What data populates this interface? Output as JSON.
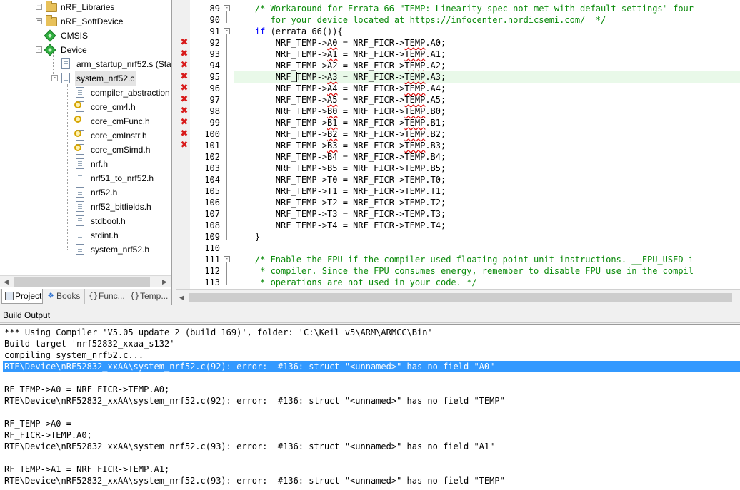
{
  "project_tree": {
    "items": [
      {
        "label": "nRF_Libraries",
        "kind": "folder"
      },
      {
        "label": "nRF_SoftDevice",
        "kind": "folder"
      },
      {
        "label": "CMSIS",
        "kind": "component"
      },
      {
        "label": "Device",
        "kind": "component"
      },
      {
        "label": "arm_startup_nrf52.s (Star",
        "kind": "file"
      },
      {
        "label": "system_nrf52.c",
        "kind": "file"
      },
      {
        "label": "compiler_abstraction",
        "kind": "file"
      },
      {
        "label": "core_cm4.h",
        "kind": "key-file"
      },
      {
        "label": "core_cmFunc.h",
        "kind": "key-file"
      },
      {
        "label": "core_cmInstr.h",
        "kind": "key-file"
      },
      {
        "label": "core_cmSimd.h",
        "kind": "key-file"
      },
      {
        "label": "nrf.h",
        "kind": "file"
      },
      {
        "label": "nrf51_to_nrf52.h",
        "kind": "file"
      },
      {
        "label": "nrf52.h",
        "kind": "file"
      },
      {
        "label": "nrf52_bitfields.h",
        "kind": "file"
      },
      {
        "label": "stdbool.h",
        "kind": "file"
      },
      {
        "label": "stdint.h",
        "kind": "file"
      },
      {
        "label": "system_nrf52.h",
        "kind": "file"
      }
    ]
  },
  "panel_tabs": [
    {
      "label": "Project",
      "icon": "project-icon",
      "active": true
    },
    {
      "label": "Books",
      "icon": "books-icon",
      "active": false
    },
    {
      "label": "Func...",
      "icon": "functions-icon",
      "active": false
    },
    {
      "label": "Temp...",
      "icon": "templates-icon",
      "active": false
    }
  ],
  "editor": {
    "lines": [
      {
        "num": "89",
        "text": "    /* Workaround for Errata 66 \"TEMP: Linearity spec not met with default settings\" four",
        "style": "comment",
        "error": false,
        "fold": "minus"
      },
      {
        "num": "90",
        "text": "       for your device located at https://infocenter.nordicsemi.com/  */",
        "style": "comment",
        "error": false
      },
      {
        "num": "91",
        "text": "    if (errata_66()){",
        "style": "code",
        "error": false,
        "fold": "minus"
      },
      {
        "num": "92",
        "text": "        NRF_TEMP->A0 = NRF_FICR->TEMP.A0;",
        "style": "code",
        "error": true
      },
      {
        "num": "93",
        "text": "        NRF_TEMP->A1 = NRF_FICR->TEMP.A1;",
        "style": "code",
        "error": true
      },
      {
        "num": "94",
        "text": "        NRF_TEMP->A2 = NRF_FICR->TEMP.A2;",
        "style": "code",
        "error": true
      },
      {
        "num": "95",
        "text": "        NRF_TEMP->A3 = NRF_FICR->TEMP.A3;",
        "style": "code",
        "error": true
      },
      {
        "num": "96",
        "text": "        NRF_TEMP->A4 = NRF_FICR->TEMP.A4;",
        "style": "code",
        "error": true
      },
      {
        "num": "97",
        "text": "        NRF_TEMP->A5 = NRF_FICR->TEMP.A5;",
        "style": "code",
        "error": true
      },
      {
        "num": "98",
        "text": "        NRF_TEMP->B0 = NRF_FICR->TEMP.B0;",
        "style": "code",
        "error": true
      },
      {
        "num": "99",
        "text": "        NRF_TEMP->B1 = NRF_FICR->TEMP.B1;",
        "style": "code",
        "error": true
      },
      {
        "num": "100",
        "text": "        NRF_TEMP->B2 = NRF_FICR->TEMP.B2;",
        "style": "code",
        "error": true
      },
      {
        "num": "101",
        "text": "        NRF_TEMP->B3 = NRF_FICR->TEMP.B3;",
        "style": "code",
        "error": true
      },
      {
        "num": "102",
        "text": "        NRF_TEMP->B4 = NRF_FICR->TEMP.B4;",
        "style": "code",
        "error": false
      },
      {
        "num": "103",
        "text": "        NRF_TEMP->B5 = NRF_FICR->TEMP.B5;",
        "style": "code",
        "error": false
      },
      {
        "num": "104",
        "text": "        NRF_TEMP->T0 = NRF_FICR->TEMP.T0;",
        "style": "code",
        "error": false
      },
      {
        "num": "105",
        "text": "        NRF_TEMP->T1 = NRF_FICR->TEMP.T1;",
        "style": "code",
        "error": false
      },
      {
        "num": "106",
        "text": "        NRF_TEMP->T2 = NRF_FICR->TEMP.T2;",
        "style": "code",
        "error": false
      },
      {
        "num": "107",
        "text": "        NRF_TEMP->T3 = NRF_FICR->TEMP.T3;",
        "style": "code",
        "error": false
      },
      {
        "num": "108",
        "text": "        NRF_TEMP->T4 = NRF_FICR->TEMP.T4;",
        "style": "code",
        "error": false
      },
      {
        "num": "109",
        "text": "    }",
        "style": "code",
        "error": false
      },
      {
        "num": "110",
        "text": "",
        "style": "code",
        "error": false
      },
      {
        "num": "111",
        "text": "    /* Enable the FPU if the compiler used floating point unit instructions. __FPU_USED i",
        "style": "comment",
        "error": false,
        "fold": "minus"
      },
      {
        "num": "112",
        "text": "     * compiler. Since the FPU consumes energy, remember to disable FPU use in the compil",
        "style": "comment",
        "error": false
      },
      {
        "num": "113",
        "text": "     * operations are not used in your code. */",
        "style": "comment",
        "error": false
      }
    ],
    "highlight_line": "95"
  },
  "build_output": {
    "title": "Build Output",
    "lines": [
      {
        "text": "*** Using Compiler 'V5.05 update 2 (build 169)', folder: 'C:\\Keil_v5\\ARM\\ARMCC\\Bin'",
        "selected": false
      },
      {
        "text": "Build target 'nrf52832_xxaa_s132'",
        "selected": false
      },
      {
        "text": "compiling system_nrf52.c...",
        "selected": false
      },
      {
        "text": "RTE\\Device\\nRF52832_xxAA\\system_nrf52.c(92): error:  #136: struct \"<unnamed>\" has no field \"A0\"",
        "selected": true
      },
      {
        "text": "",
        "selected": false
      },
      {
        "text": "RF_TEMP->A0 = NRF_FICR->TEMP.A0;",
        "selected": false
      },
      {
        "text": "RTE\\Device\\nRF52832_xxAA\\system_nrf52.c(92): error:  #136: struct \"<unnamed>\" has no field \"TEMP\"",
        "selected": false
      },
      {
        "text": "",
        "selected": false
      },
      {
        "text": "RF_TEMP->A0 =",
        "selected": false
      },
      {
        "text": "RF_FICR->TEMP.A0;",
        "selected": false
      },
      {
        "text": "RTE\\Device\\nRF52832_xxAA\\system_nrf52.c(93): error:  #136: struct \"<unnamed>\" has no field \"A1\"",
        "selected": false
      },
      {
        "text": "",
        "selected": false
      },
      {
        "text": "RF_TEMP->A1 = NRF_FICR->TEMP.A1;",
        "selected": false
      },
      {
        "text": "RTE\\Device\\nRF52832_xxAA\\system_nrf52.c(93): error:  #136: struct \"<unnamed>\" has no field \"TEMP\"",
        "selected": false
      }
    ]
  },
  "colors": {
    "selection": "#3399ff",
    "comment": "#0a8a0a",
    "keyword": "#0000ff",
    "error_mark": "#d81b1b",
    "current_line": "#e9f9e9"
  }
}
